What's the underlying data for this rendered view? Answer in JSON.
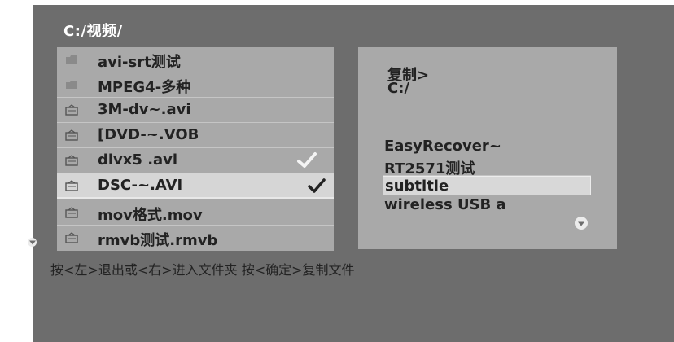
{
  "path": "C:/视频/",
  "file_list": [
    {
      "name": "avi-srt测试",
      "icon": "folder-icon",
      "checked": false
    },
    {
      "name": "MPEG4-多种",
      "icon": "folder-icon",
      "checked": false
    },
    {
      "name": "3M-dv~.avi",
      "icon": "video-file-icon",
      "checked": false
    },
    {
      "name": "[DVD-~.VOB",
      "icon": "video-file-icon",
      "checked": false
    },
    {
      "name": "divx5 .avi",
      "icon": "video-file-icon",
      "checked": true
    },
    {
      "name": "DSC-~.AVI",
      "icon": "video-file-icon",
      "checked": true
    },
    {
      "name": "mov格式.mov",
      "icon": "video-file-icon",
      "checked": false
    },
    {
      "name": "rmvb测试.rmvb",
      "icon": "video-file-icon",
      "checked": false
    }
  ],
  "selected_file_index": 5,
  "copy_panel": {
    "title": "复制>",
    "destination": "C:/",
    "folders": [
      "EasyRecover~",
      "RT2571测试",
      "subtitle",
      "wireless USB a"
    ],
    "selected_folder_index": 2
  },
  "hint": "按<左>退出或<右>进入文件夹 按<确定>复制文件"
}
